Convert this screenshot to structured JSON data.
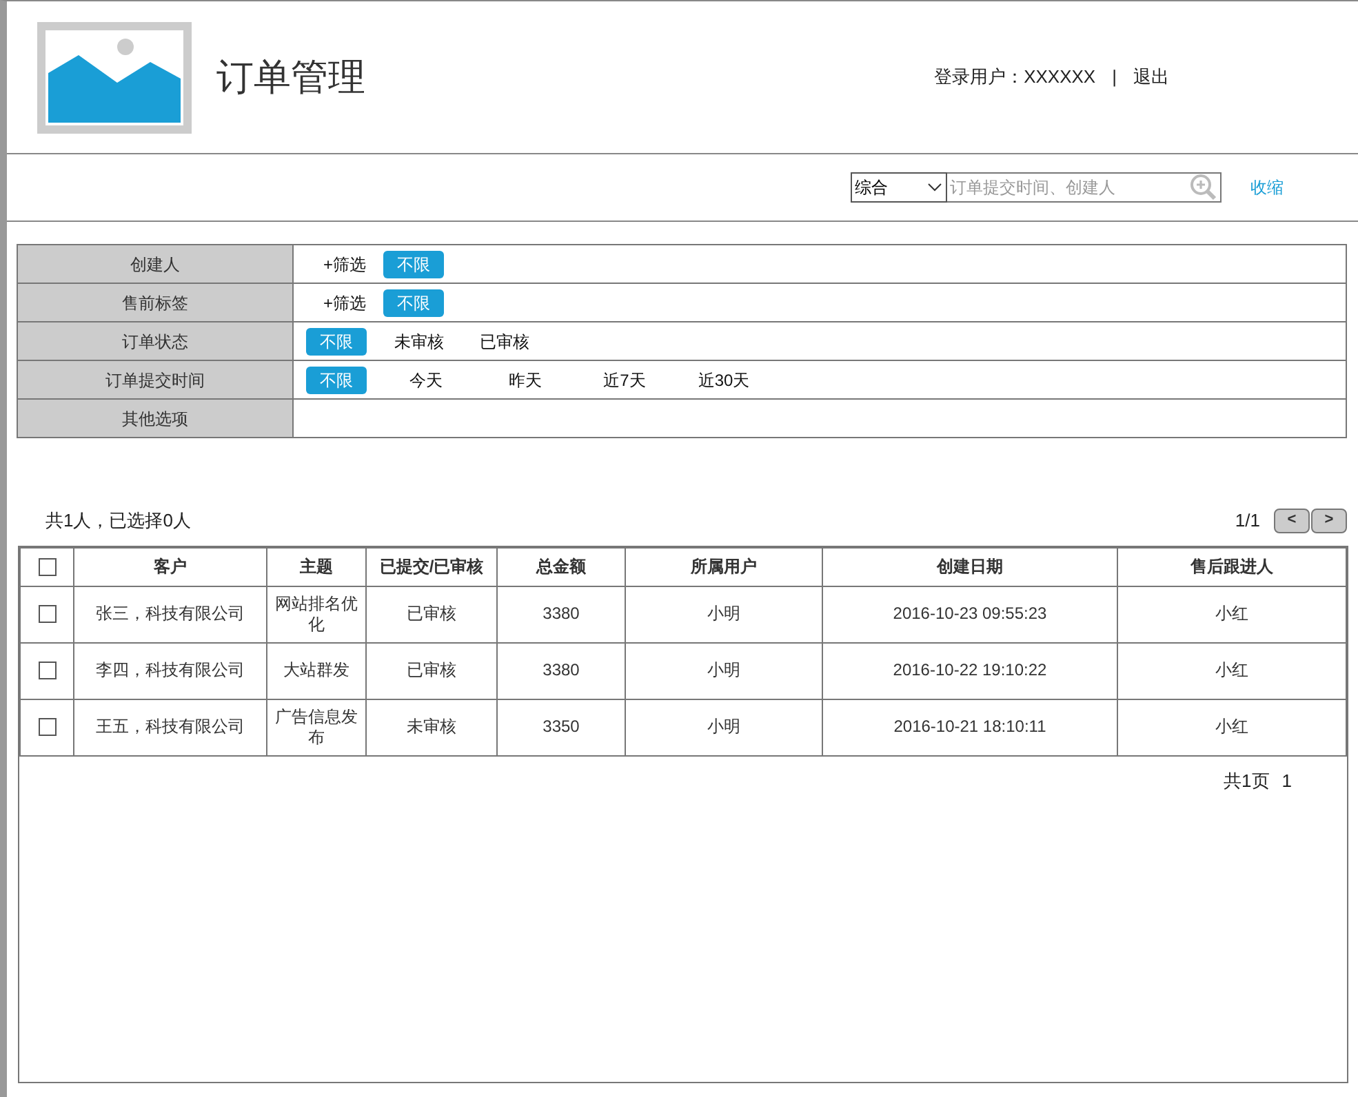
{
  "header": {
    "title": "订单管理",
    "user_label": "登录用户：XXXXXX",
    "separator": "|",
    "logout": "退出"
  },
  "search": {
    "scope": "综合",
    "placeholder": "订单提交时间、创建人",
    "collapse": "收缩"
  },
  "filters": [
    {
      "label": "创建人",
      "items": [
        {
          "kind": "add",
          "text": "+筛选"
        },
        {
          "kind": "option",
          "text": "不限",
          "selected": true
        }
      ]
    },
    {
      "label": "售前标签",
      "items": [
        {
          "kind": "add",
          "text": "+筛选"
        },
        {
          "kind": "option",
          "text": "不限",
          "selected": true
        }
      ]
    },
    {
      "label": "订单状态",
      "items": [
        {
          "kind": "option",
          "text": "不限",
          "selected": true
        },
        {
          "kind": "option",
          "text": "未审核",
          "selected": false
        },
        {
          "kind": "option",
          "text": "已审核",
          "selected": false
        }
      ]
    },
    {
      "label": "订单提交时间",
      "items": [
        {
          "kind": "option",
          "text": "不限",
          "selected": true
        },
        {
          "kind": "option",
          "text": "今天",
          "selected": false
        },
        {
          "kind": "option",
          "text": "昨天",
          "selected": false
        },
        {
          "kind": "option",
          "text": "近7天",
          "selected": false
        },
        {
          "kind": "option",
          "text": "近30天",
          "selected": false
        }
      ]
    },
    {
      "label": "其他选项"
    }
  ],
  "summary": "共1人，已选择0人",
  "pager": {
    "page": "1/1",
    "prev": "<",
    "next": ">"
  },
  "table": {
    "columns": [
      "客户",
      "主题",
      "已提交/已审核",
      "总金额",
      "所属用户",
      "创建日期",
      "售后跟进人"
    ],
    "header_checked": false,
    "rows": [
      {
        "checked": false,
        "cells": [
          "张三，科技有限公司",
          "网站排名优化",
          "已审核",
          "3380",
          "小明",
          "2016-10-23 09:55:23",
          "小红"
        ]
      },
      {
        "checked": false,
        "cells": [
          "李四，科技有限公司",
          "大站群发",
          "已审核",
          "3380",
          "小明",
          "2016-10-22 19:10:22",
          "小红"
        ]
      },
      {
        "checked": false,
        "cells": [
          "王五，科技有限公司",
          "广告信息发布",
          "未审核",
          "3350",
          "小明",
          "2016-10-21 18:10:11",
          "小红"
        ]
      }
    ]
  },
  "footer": {
    "total_pages": "共1页",
    "current_page": "1"
  }
}
